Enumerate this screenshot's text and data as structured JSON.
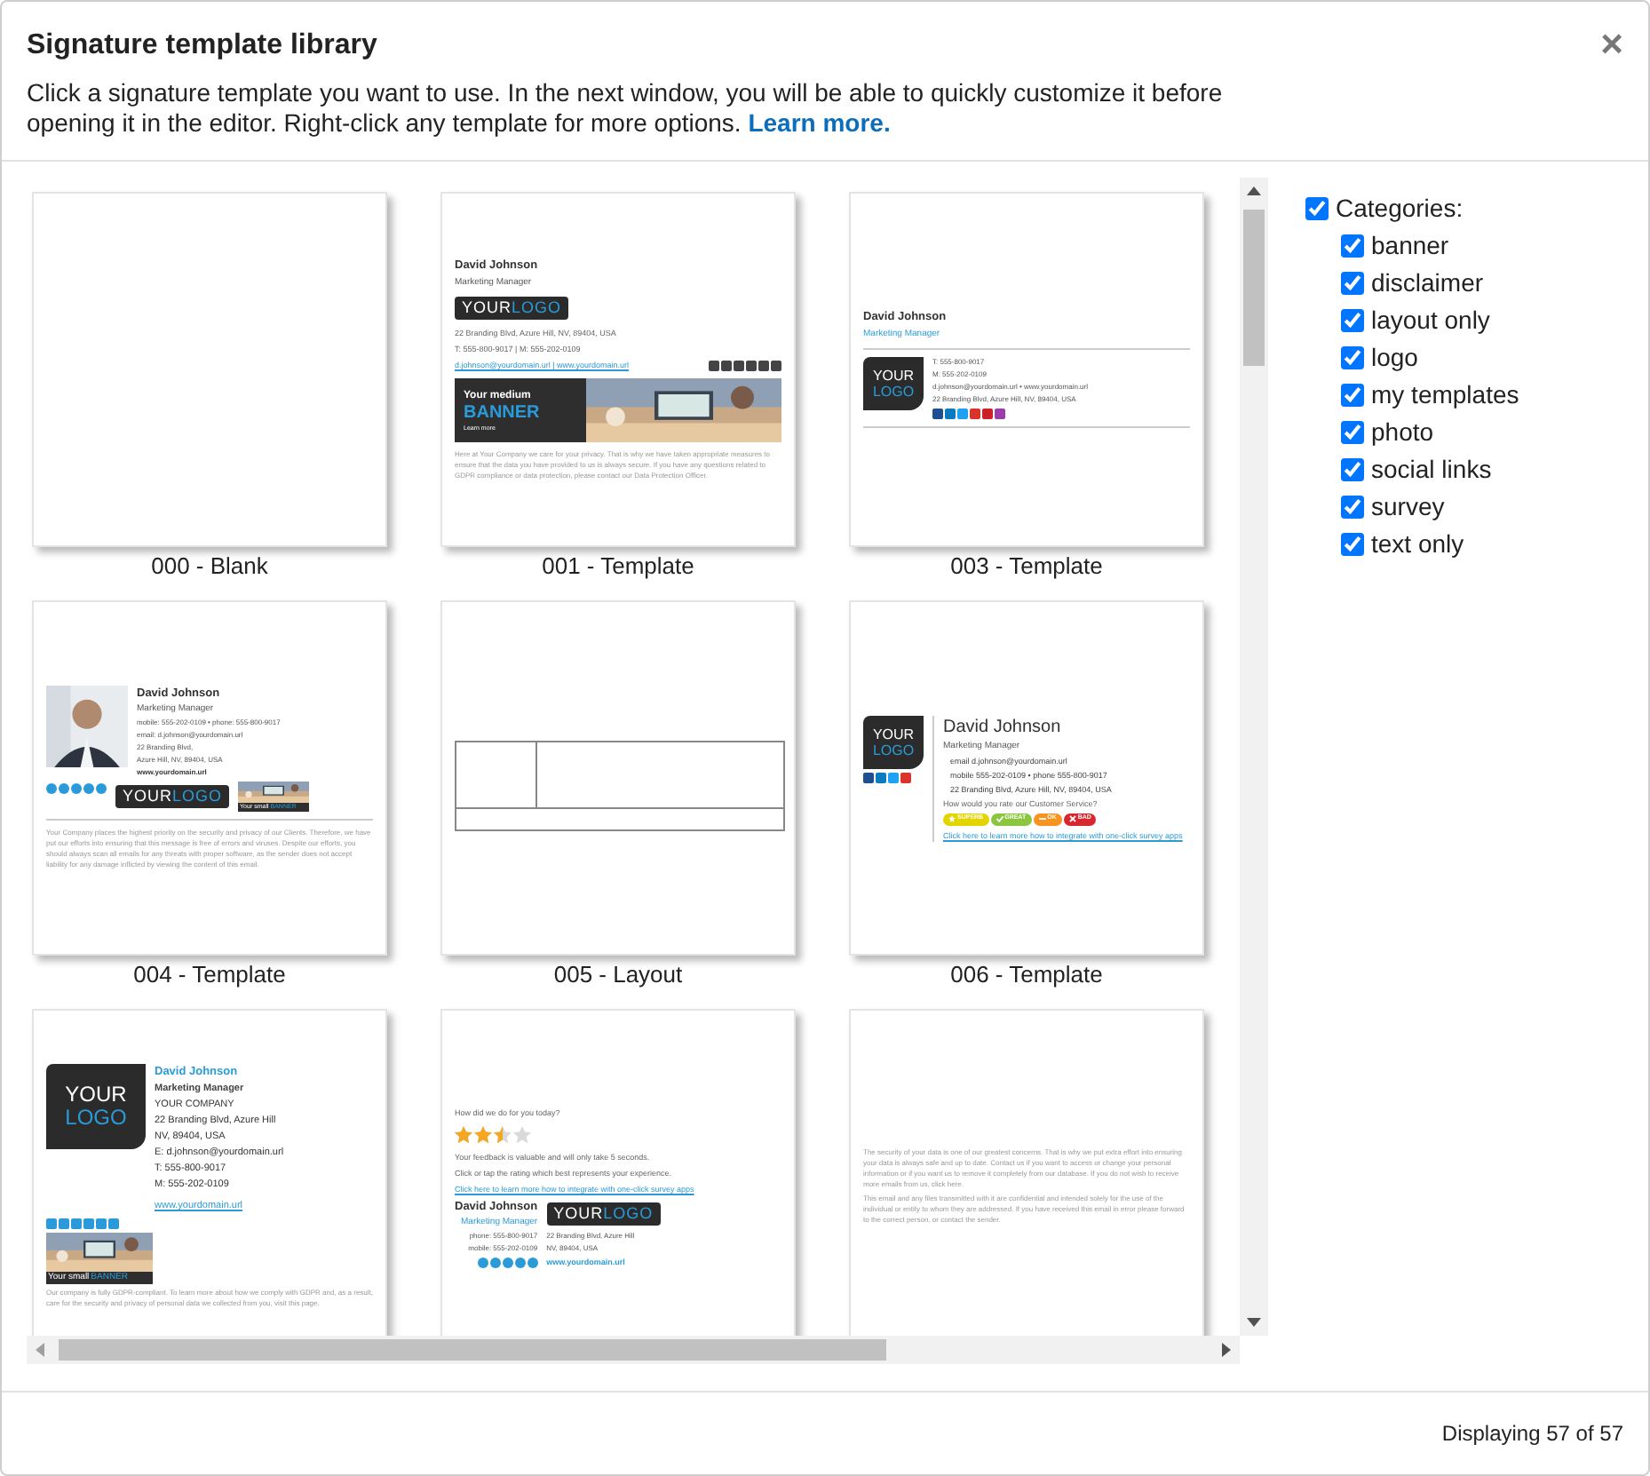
{
  "window": {
    "title": "Signature template library",
    "close": "×"
  },
  "description": {
    "text": "Click a signature template you want to use. In the next window, you will be able to quickly customize it before opening it in the editor. Right-click any template for more options.",
    "link": "Learn more."
  },
  "templates": [
    {
      "caption": "000 - Blank"
    },
    {
      "caption": "001 - Template",
      "blocks": [
        {
          "kind": "name",
          "text": "David Johnson"
        },
        {
          "kind": "job-title",
          "text": "Marketing Manager"
        },
        {
          "kind": "logo-wide",
          "parts": [
            "YOUR",
            "LOGO"
          ]
        },
        {
          "kind": "note",
          "text": "22 Branding Blvd, Azure Hill, NV, 89404, USA"
        },
        {
          "kind": "note",
          "text": "T: 555-800-9017 | M: 555-202-0109"
        },
        {
          "kind": "row",
          "cols": [
            {
              "kind": "column-fill",
              "blocks": [
                {
                  "kind": "survey-link",
                  "text": "d.johnson@yourdomain.url | www.yourdomain.url"
                }
              ]
            },
            {
              "kind": "column",
              "blocks": [
                {
                  "kind": "icons-square",
                  "items": [
                    {
                      "color": "#444444"
                    },
                    {
                      "color": "#444444"
                    },
                    {
                      "color": "#444444"
                    },
                    {
                      "color": "#444444"
                    },
                    {
                      "color": "#444444"
                    },
                    {
                      "color": "#444444"
                    }
                  ]
                }
              ]
            }
          ]
        },
        {
          "kind": "banner-medium",
          "text": "Your medium",
          "highlight": "BANNER",
          "action": "Learn more"
        },
        {
          "kind": "disclaimer",
          "text": "Here at Your Company we care for your privacy. That is why we have taken appropriate measures to ensure that the data you have provided to us is always secure. If you have any questions related to GDPR compliance or data protection, please contact our Data Protection Officer."
        }
      ]
    },
    {
      "caption": "003 - Template",
      "blocks": [
        {
          "kind": "name",
          "text": "David Johnson"
        },
        {
          "kind": "job-title-blue",
          "text": "Marketing Manager"
        },
        {
          "kind": "rule"
        },
        {
          "kind": "row",
          "cols": [
            {
              "kind": "column",
              "blocks": [
                {
                  "kind": "logo-square",
                  "parts": [
                    "YOUR",
                    "LOGO"
                  ]
                }
              ]
            },
            {
              "kind": "column-fill",
              "blocks": [
                {
                  "kind": "contact",
                  "text": "T: 555-800-9017"
                },
                {
                  "kind": "contact",
                  "text": "M: 555-202-0109"
                },
                {
                  "kind": "contact",
                  "text": "d.johnson@yourdomain.url • www.yourdomain.url"
                },
                {
                  "kind": "contact",
                  "text": "22 Branding Blvd, Azure Hill, NV, 89404, USA"
                },
                {
                  "kind": "icons-square",
                  "items": [
                    {
                      "color": "#1d4f91"
                    },
                    {
                      "color": "#0a7bc1"
                    },
                    {
                      "color": "#1da1f2"
                    },
                    {
                      "color": "#d9342b"
                    },
                    {
                      "color": "#cb2027"
                    },
                    {
                      "color": "#9b3fa8"
                    }
                  ]
                }
              ]
            }
          ]
        },
        {
          "kind": "rule"
        }
      ]
    },
    {
      "caption": "004 - Template",
      "blocks": [
        {
          "kind": "row",
          "cols": [
            {
              "kind": "column"
            },
            {
              "kind": "column-fill",
              "blocks": [
                {
                  "kind": "name",
                  "text": "David Johnson"
                },
                {
                  "kind": "job-title",
                  "text": "Marketing Manager"
                },
                {
                  "kind": "contact",
                  "text": "mobile: 555-202-0109 • phone: 555-800-9017"
                },
                {
                  "kind": "contact",
                  "text": "email: d.johnson@yourdomain.url"
                },
                {
                  "kind": "contact",
                  "text": "22 Branding Blvd,"
                },
                {
                  "kind": "contact",
                  "text": "Azure Hill, NV, 89404, USA"
                },
                {
                  "kind": "contact-bold",
                  "text": "www.yourdomain.url"
                }
              ]
            }
          ]
        },
        {
          "kind": "row",
          "cols": [
            {
              "kind": "column",
              "blocks": [
                {
                  "kind": "icons-round",
                  "items": [
                    {
                      "color": "#2a9bd8"
                    },
                    {
                      "color": "#2a9bd8"
                    },
                    {
                      "color": "#2a9bd8"
                    },
                    {
                      "color": "#2a9bd8"
                    },
                    {
                      "color": "#2a9bd8"
                    }
                  ]
                }
              ]
            },
            {
              "kind": "column",
              "blocks": [
                {
                  "kind": "logo-wide",
                  "parts": [
                    "YOUR",
                    "LOGO"
                  ]
                }
              ]
            },
            {
              "kind": "column",
              "blocks": [
                {
                  "kind": "banner-small",
                  "text": "Your small",
                  "highlight": "BANNER"
                }
              ]
            }
          ]
        },
        {
          "kind": "rule"
        },
        {
          "kind": "disclaimer",
          "text": "Your Company places the highest priority on the security and privacy of our Clients. Therefore, we have put our efforts into ensuring that this message is free of errors and viruses. Despite our efforts, you should always scan all emails for any threats with proper software, as the sender does not accept liability for any damage inflicted by viewing the content of this email."
        }
      ]
    },
    {
      "caption": "005 - Layout",
      "blocks": [
        {
          "kind": "layout"
        }
      ]
    },
    {
      "caption": "006 - Template",
      "blocks": [
        {
          "kind": "row",
          "cols": [
            {
              "kind": "column",
              "blocks": [
                {
                  "kind": "logo-square",
                  "parts": [
                    "YOUR",
                    "LOGO"
                  ]
                },
                {
                  "kind": "icons-square",
                  "items": [
                    {
                      "color": "#1d4f91"
                    },
                    {
                      "color": "#0a7bc1"
                    },
                    {
                      "color": "#1da1f2"
                    },
                    {
                      "color": "#d9342b"
                    }
                  ]
                }
              ]
            },
            {
              "kind": "column-divided",
              "blocks": [
                {
                  "kind": "name-large",
                  "text": "David Johnson"
                },
                {
                  "kind": "job-title",
                  "text": "Marketing Manager"
                },
                {
                  "kind": "bullet",
                  "text": "email d.johnson@yourdomain.url"
                },
                {
                  "kind": "bullet",
                  "text": "mobile 555-202-0109 • phone 555-800-9017"
                },
                {
                  "kind": "bullet",
                  "text": "22 Branding Blvd, Azure Hill, NV, 89404, USA"
                },
                {
                  "kind": "note",
                  "text": "How would you rate our Customer Service?"
                },
                {
                  "kind": "buttons",
                  "items": [
                    {
                      "label": "SUPERB",
                      "kind": "star",
                      "color": "#e3d400"
                    },
                    {
                      "label": "GREAT",
                      "kind": "check",
                      "color": "#8cc63f"
                    },
                    {
                      "label": "OK",
                      "kind": "minus",
                      "color": "#f7931e"
                    },
                    {
                      "label": "BAD",
                      "kind": "cross",
                      "color": "#d7282f"
                    }
                  ]
                },
                {
                  "kind": "survey-link",
                  "text": "Click here to learn more how to integrate with one-click survey apps"
                }
              ]
            }
          ]
        }
      ]
    },
    {
      "blocks": [
        {
          "kind": "row",
          "cols": [
            {
              "kind": "column",
              "blocks": [
                {
                  "kind": "logo-big",
                  "parts": [
                    "YOUR",
                    "LOGO"
                  ]
                }
              ]
            },
            {
              "kind": "column-fill",
              "blocks": [
                {
                  "kind": "name-blue",
                  "text": "David Johnson"
                },
                {
                  "kind": "job-title-bold",
                  "text": "Marketing Manager"
                },
                {
                  "kind": "contact-large",
                  "text": "YOUR COMPANY"
                },
                {
                  "kind": "contact-large",
                  "text": "22 Branding Blvd, Azure Hill"
                },
                {
                  "kind": "contact-large",
                  "text": "NV, 89404, USA"
                },
                {
                  "kind": "contact-large",
                  "text": "E: d.johnson@yourdomain.url"
                },
                {
                  "kind": "contact-large",
                  "text": "T: 555-800-9017"
                },
                {
                  "kind": "contact-large",
                  "text": "M: 555-202-0109"
                },
                {
                  "kind": "link-large",
                  "text": "www.yourdomain.url"
                }
              ]
            }
          ]
        },
        {
          "kind": "icons-square",
          "items": [
            {
              "color": "#2a9bd8"
            },
            {
              "color": "#2a9bd8"
            },
            {
              "color": "#2a9bd8"
            },
            {
              "color": "#2a9bd8"
            },
            {
              "color": "#2a9bd8"
            },
            {
              "color": "#2a9bd8"
            }
          ]
        },
        {
          "kind": "banner-large",
          "text": "Your small",
          "highlight": "BANNER"
        },
        {
          "kind": "disclaimer",
          "text": "Our company is fully GDPR-compliant. To learn more about how we comply with GDPR and, as a result, care for the security and privacy of personal data we collected from you, visit this page."
        }
      ]
    },
    {
      "blocks": [
        {
          "kind": "note",
          "text": "How did we do for you today?"
        },
        {
          "kind": "stars",
          "stars": 2.5
        },
        {
          "kind": "note",
          "text": "Your feedback is valuable and will only take 5 seconds."
        },
        {
          "kind": "note",
          "text": "Click or tap the rating which best represents your experience."
        },
        {
          "kind": "survey-link",
          "text": "Click here to learn more how to integrate with one-click survey apps"
        },
        {
          "kind": "row",
          "cols": [
            {
              "kind": "column-right",
              "blocks": [
                {
                  "kind": "name",
                  "text": "David Johnson"
                },
                {
                  "kind": "job-title-blue",
                  "text": "Marketing Manager"
                },
                {
                  "kind": "contact",
                  "text": "phone: 555-800-9017"
                },
                {
                  "kind": "contact",
                  "text": "mobile: 555-202-0109"
                },
                {
                  "kind": "icons-round",
                  "items": [
                    {
                      "color": "#2a9bd8"
                    },
                    {
                      "color": "#2a9bd8"
                    },
                    {
                      "color": "#2a9bd8"
                    },
                    {
                      "color": "#2a9bd8"
                    },
                    {
                      "color": "#2a9bd8"
                    }
                  ]
                }
              ]
            },
            {
              "kind": "column-fill",
              "blocks": [
                {
                  "kind": "logo-wide",
                  "parts": [
                    "YOUR",
                    "LOGO"
                  ]
                },
                {
                  "kind": "contact",
                  "text": "22 Branding Blvd, Azure Hill"
                },
                {
                  "kind": "contact",
                  "text": "NV, 89404, USA"
                },
                {
                  "kind": "contact-link",
                  "text": "www.yourdomain.url"
                }
              ]
            }
          ]
        }
      ]
    },
    {
      "blocks": [
        {
          "kind": "disclaimer",
          "text": "The security of your data is one of our greatest concerns. That is why we put extra effort into ensuring your data is always safe and up to date. Contact us if you want to access or change your personal information or if you want us to remove it completely from our database. If you do not wish to receive more emails from us, click here."
        },
        {
          "kind": "disclaimer",
          "text": "This email and any files transmitted with it are confidential and intended solely for the use of the individual or entity to whom they are addressed. If you have received this email in error please forward to the correct person, or contact the sender."
        }
      ]
    }
  ],
  "categories": {
    "label": "Categories:",
    "checked": true,
    "items": [
      {
        "label": "banner",
        "checked": true
      },
      {
        "label": "disclaimer",
        "checked": true
      },
      {
        "label": "layout only",
        "checked": true
      },
      {
        "label": "logo",
        "checked": true
      },
      {
        "label": "my templates",
        "checked": true
      },
      {
        "label": "photo",
        "checked": true
      },
      {
        "label": "social links",
        "checked": true
      },
      {
        "label": "survey",
        "checked": true
      },
      {
        "label": "text only",
        "checked": true
      }
    ]
  },
  "status": "Displaying 57 of 57"
}
